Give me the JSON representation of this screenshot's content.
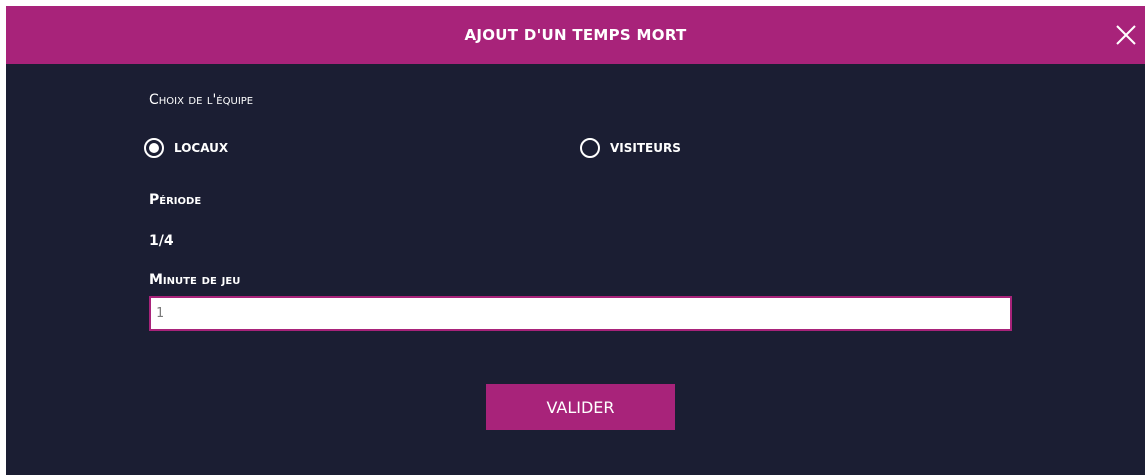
{
  "dialog": {
    "title": "AJOUT D'UN TEMPS MORT",
    "close_icon": "close-icon"
  },
  "team_choice": {
    "label": "Choix de l'équipe",
    "options": [
      {
        "label": "LOCAUX",
        "selected": true
      },
      {
        "label": "VISITEURS",
        "selected": false
      }
    ]
  },
  "period": {
    "label": "Période",
    "value": "1/4"
  },
  "game_minute": {
    "label": "Minute de jeu",
    "value": "1",
    "placeholder": ""
  },
  "submit": {
    "label": "VALIDER"
  },
  "colors": {
    "header": "#a8237a",
    "background": "#1b1e33",
    "accent": "#a8237a",
    "text": "#ffffff"
  }
}
